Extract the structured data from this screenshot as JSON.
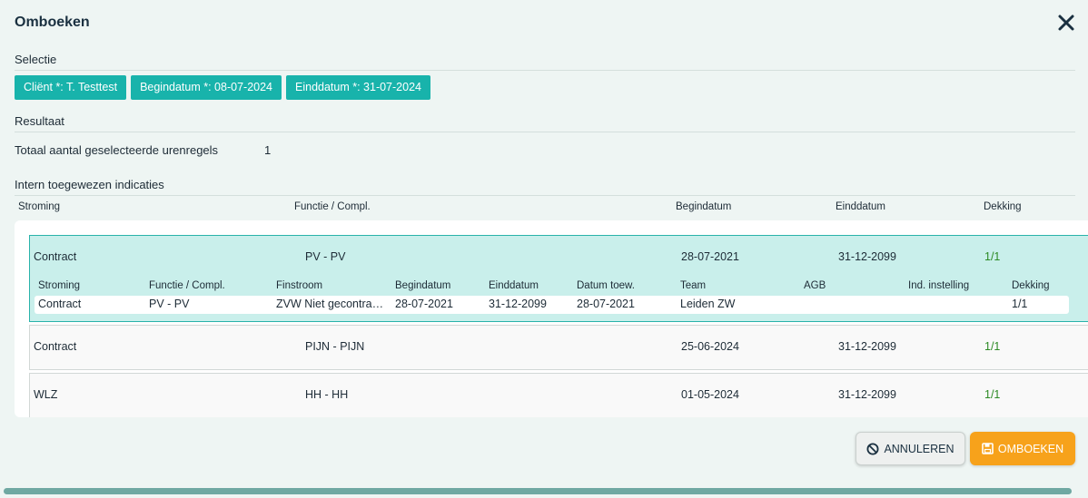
{
  "dialog": {
    "title": "Omboeken"
  },
  "selectie": {
    "label": "Selectie",
    "chips": [
      "Cliënt *: T. Testtest",
      "Begindatum *: 08-07-2024",
      "Einddatum *: 31-07-2024"
    ]
  },
  "resultaat": {
    "label": "Resultaat",
    "total_label": "Totaal aantal geselecteerde urenregels",
    "total_value": "1"
  },
  "indicaties": {
    "label": "Intern toegewezen indicaties",
    "columns": [
      "Stroming",
      "Functie / Compl.",
      "Begindatum",
      "Einddatum",
      "Dekking"
    ],
    "rows": [
      {
        "stroming": "Contract",
        "functie": "PV - PV",
        "begindatum": "28-07-2021",
        "einddatum": "31-12-2099",
        "dekking": "1/1"
      },
      {
        "stroming": "Contract",
        "functie": "PIJN - PIJN",
        "begindatum": "25-06-2024",
        "einddatum": "31-12-2099",
        "dekking": "1/1"
      },
      {
        "stroming": "WLZ",
        "functie": "HH - HH",
        "begindatum": "01-05-2024",
        "einddatum": "31-12-2099",
        "dekking": "1/1"
      }
    ],
    "detail": {
      "columns": [
        "Stroming",
        "Functie / Compl.",
        "Finstroom",
        "Begindatum",
        "Einddatum",
        "Datum toew.",
        "Team",
        "AGB",
        "Ind. instelling",
        "Dekking"
      ],
      "row": [
        "Contract",
        "PV - PV",
        "ZVW Niet gecontra…",
        "28-07-2021",
        "31-12-2099",
        "28-07-2021",
        "Leiden ZW",
        "",
        "",
        "1/1"
      ]
    }
  },
  "buttons": {
    "cancel": "ANNULEREN",
    "submit": "OMBOEKEN"
  },
  "icons": {
    "close": "close-icon",
    "cancel": "ban-icon",
    "submit": "save-icon"
  },
  "colors": {
    "accent": "#18b3ab",
    "submit": "#f7a21b",
    "positive": "#2c8a24"
  }
}
